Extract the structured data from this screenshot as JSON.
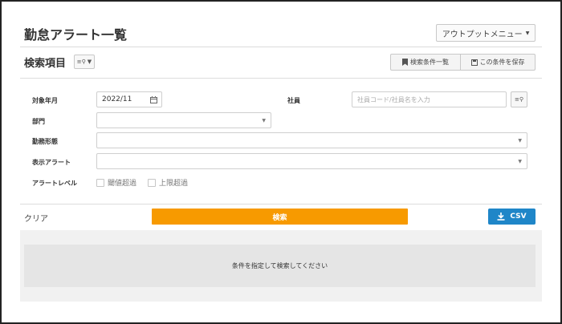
{
  "header": {
    "title": "勤怠アラート一覧",
    "output_menu_label": "アウトプットメニュー"
  },
  "search_section": {
    "title": "検索項目",
    "saved_conditions_label": "検索条件一覧",
    "save_condition_label": "この条件を保存"
  },
  "form": {
    "target_month_label": "対象年月",
    "target_month_value": "2022/11",
    "employee_label": "社員",
    "employee_placeholder": "社員コード/社員名を入力",
    "department_label": "部門",
    "department_value": "",
    "work_type_label": "勤務形態",
    "work_type_value": "",
    "alert_display_label": "表示アラート",
    "alert_display_value": "",
    "alert_level_label": "アラートレベル",
    "alert_levels": [
      "閾値超過",
      "上限超過"
    ]
  },
  "actions": {
    "clear_label": "クリア",
    "search_label": "検索",
    "csv_label": "CSV"
  },
  "results": {
    "empty_message": "条件を指定して検索してください"
  }
}
